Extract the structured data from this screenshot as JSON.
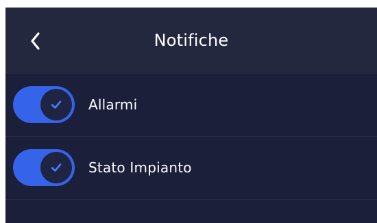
{
  "header": {
    "title": "Notifiche",
    "back_icon": "chevron-left-icon"
  },
  "settings": [
    {
      "label": "Allarmi",
      "enabled": true,
      "icon": "check-icon"
    },
    {
      "label": "Stato Impianto",
      "enabled": true,
      "icon": "check-icon"
    }
  ],
  "colors": {
    "background": "#1b1f3a",
    "header_background": "#23283f",
    "toggle_on": "#3563ea",
    "toggle_knob": "#1f2442",
    "text": "#ffffff"
  }
}
